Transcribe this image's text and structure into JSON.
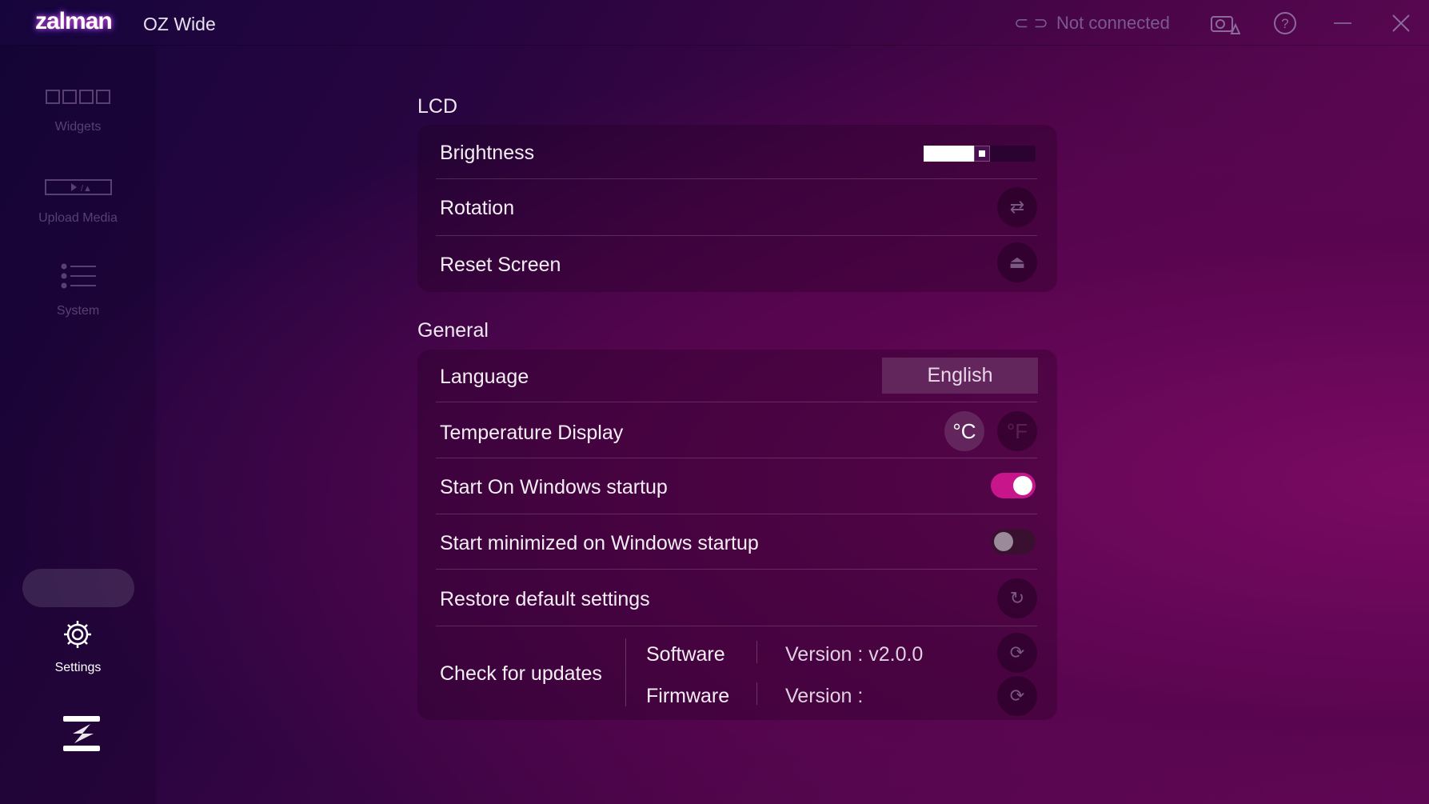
{
  "app": {
    "brand": "zalman",
    "title": "OZ Wide"
  },
  "titlebar": {
    "status": "Not connected",
    "icons": [
      "link-icon",
      "camera-warning-icon",
      "help-icon",
      "minimize-icon",
      "close-icon"
    ]
  },
  "sidebar": {
    "items": [
      {
        "label": "Widgets",
        "icon": "widgets-icon"
      },
      {
        "label": "Upload Media",
        "icon": "upload-media-icon"
      },
      {
        "label": "System",
        "icon": "system-list-icon"
      },
      {
        "label": "Settings",
        "icon": "gear-icon",
        "active": true
      }
    ]
  },
  "lcd": {
    "heading": "LCD",
    "brightness_label": "Brightness",
    "brightness_value": 0.45,
    "rotation_label": "Rotation",
    "reset_label": "Reset Screen"
  },
  "general": {
    "heading": "General",
    "language_label": "Language",
    "language_value": "English",
    "temp_label": "Temperature Display",
    "temp_c": "°C",
    "temp_f": "°F",
    "temp_selected": "C",
    "start_label": "Start On Windows startup",
    "start_on": true,
    "minimized_label": "Start minimized on Windows startup",
    "minimized_on": false,
    "restore_label": "Restore default settings",
    "updates_label": "Check for updates",
    "software_label": "Software",
    "software_version": "Version : v2.0.0",
    "firmware_label": "Firmware",
    "firmware_version": "Version :"
  },
  "colors": {
    "accent": "#c8158c",
    "toggle_off": "#3a1030"
  }
}
